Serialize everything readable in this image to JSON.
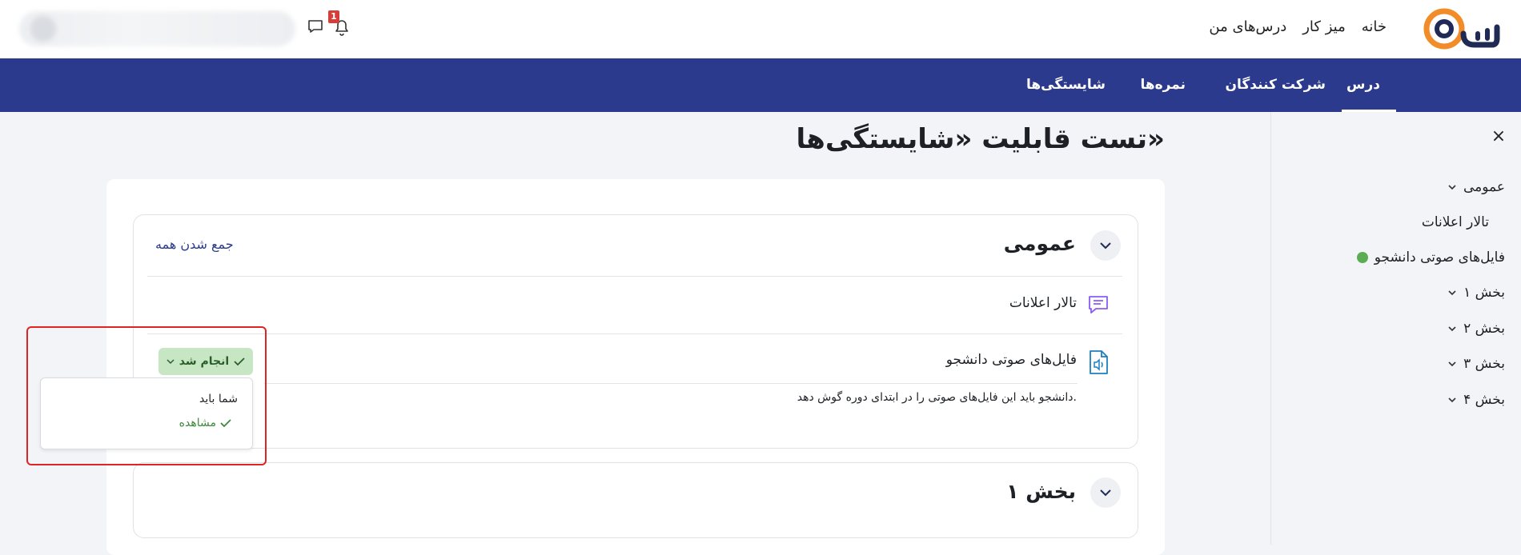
{
  "topbar": {
    "logo_text": "وب",
    "nav": [
      "خانه",
      "میز کار",
      "درس‌های من"
    ],
    "notification_count": "1"
  },
  "secnav": {
    "items": [
      "درس",
      "شرکت کنندگان",
      "نمره‌ها",
      "شایستگی‌ها"
    ],
    "active_index": 0
  },
  "drawer": {
    "close": "×",
    "items": [
      {
        "label": "عمومی",
        "kind": "section"
      },
      {
        "label": "تالار اعلانات",
        "kind": "activity"
      },
      {
        "label": "فایل‌های صوتی دانشجو",
        "kind": "activity-current"
      },
      {
        "label": "بخش ۱",
        "kind": "section"
      },
      {
        "label": "بخش ۲",
        "kind": "section"
      },
      {
        "label": "بخش ۳",
        "kind": "section"
      },
      {
        "label": "بخش ۴",
        "kind": "section"
      }
    ]
  },
  "page": {
    "title": "تست قابلیت «شایستگی‌ها»",
    "collapse_all": "جمع شدن همه",
    "sections": [
      {
        "title": "عمومی"
      },
      {
        "title": "بخش ۱"
      }
    ],
    "activities": [
      {
        "name": "تالار اعلانات",
        "icon": "forum-icon"
      },
      {
        "name": "فایل‌های صوتی دانشجو",
        "icon": "audio-file-icon",
        "description": "دانشجو باید این فایل‌های صوتی را در ابتدای دوره گوش دهد."
      }
    ]
  },
  "completion": {
    "button_label": "انجام شد",
    "dropdown_header": "شما باید",
    "condition": "مشاهده"
  },
  "colors": {
    "nav_bg": "#2b3a8c",
    "done_bg": "#c6e6c4",
    "highlight": "#e02424",
    "logo_orange": "#f28c28"
  }
}
